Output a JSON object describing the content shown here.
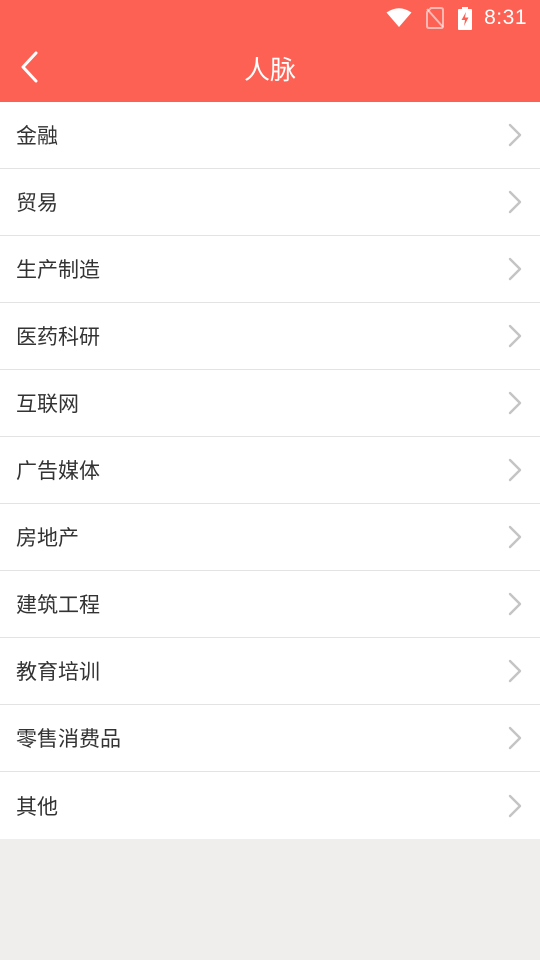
{
  "status_bar": {
    "time": "8:31",
    "icons": [
      "wifi-icon",
      "no-sim-icon",
      "battery-charging-icon"
    ]
  },
  "header": {
    "title": "人脉",
    "back_icon": "chevron-left-icon",
    "background_color": "#fd6154"
  },
  "industries": [
    {
      "label": "金融"
    },
    {
      "label": "贸易"
    },
    {
      "label": "生产制造"
    },
    {
      "label": "医药科研"
    },
    {
      "label": "互联网"
    },
    {
      "label": "广告媒体"
    },
    {
      "label": "房地产"
    },
    {
      "label": "建筑工程"
    },
    {
      "label": "教育培训"
    },
    {
      "label": "零售消费品"
    },
    {
      "label": "其他"
    }
  ],
  "item_icon": "chevron-right-icon"
}
